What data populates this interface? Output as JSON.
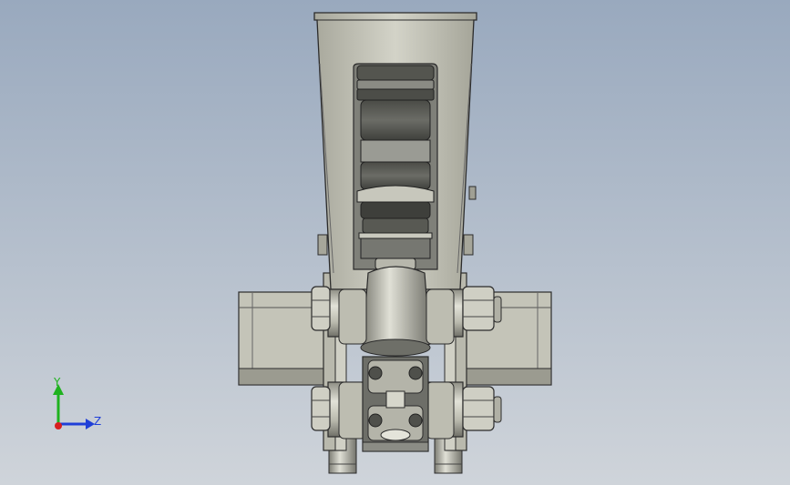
{
  "viewport": {
    "background_top": "#99a9be",
    "background_bottom": "#cfd4da"
  },
  "model": {
    "part_color": "#c9c9bd",
    "shadow_color": "#6e6f68",
    "edge_color": "#2b2b2b"
  },
  "triad": {
    "y_label": "Y",
    "z_label": "Z",
    "y_color": "#1fb21f",
    "z_color": "#1f3fd8",
    "x_color": "#d81f1f"
  }
}
